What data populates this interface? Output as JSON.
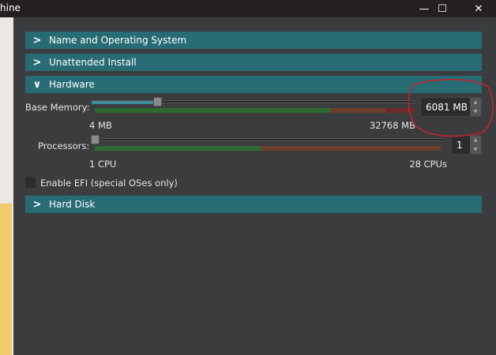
{
  "window": {
    "title": "hine",
    "controls": [
      "—",
      "☐",
      "✕"
    ]
  },
  "sections": [
    {
      "label": "Name and Operating System",
      "expanded": false
    },
    {
      "label": "Unattended Install",
      "expanded": false
    },
    {
      "label": "Hardware",
      "expanded": true
    },
    {
      "label": "Hard Disk",
      "expanded": false
    }
  ],
  "hardware": {
    "memory": {
      "label": "Base Memory:",
      "value": "6081 MB",
      "min_label": "4 MB",
      "max_label": "32768 MB",
      "min": 4,
      "max": 32768,
      "current": 6081
    },
    "processors": {
      "label": "Processors:",
      "value": "1",
      "min_label": "1 CPU",
      "max_label": "28 CPUs",
      "min": 1,
      "max": 28,
      "current": 1
    },
    "efi": {
      "label": "Enable EFI (special OSes only)",
      "checked": false
    }
  },
  "colors": {
    "section": "#276b74",
    "green": "#2d6a2f",
    "brown": "#6b3f2c",
    "red": "#6e2a2a",
    "annotation": "#c8202a"
  }
}
